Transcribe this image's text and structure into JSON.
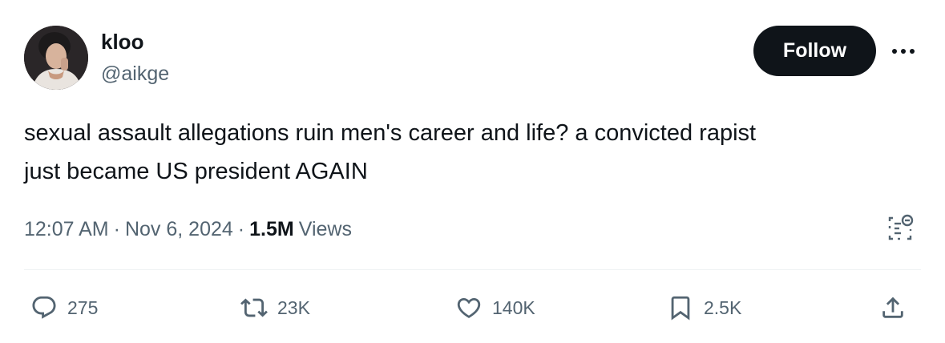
{
  "author": {
    "display_name": "kloo",
    "handle": "@aikge"
  },
  "follow_label": "Follow",
  "tweet": {
    "text": "sexual assault allegations ruin men's career and life? a convicted rapist\njust became US president AGAIN"
  },
  "meta": {
    "time": "12:07 AM",
    "date": "Nov 6, 2024",
    "views_count": "1.5M",
    "views_label": "Views"
  },
  "actions": {
    "replies": "275",
    "reposts": "23K",
    "likes": "140K",
    "bookmarks": "2.5K"
  },
  "colors": {
    "text": "#0f1419",
    "secondary": "#536471",
    "follow_bg": "#0f1419",
    "divider": "#eff3f4"
  },
  "icons": [
    "avatar-image",
    "more-icon",
    "community-notes-icon",
    "reply-icon",
    "repost-icon",
    "like-icon",
    "bookmark-icon",
    "share-icon"
  ]
}
